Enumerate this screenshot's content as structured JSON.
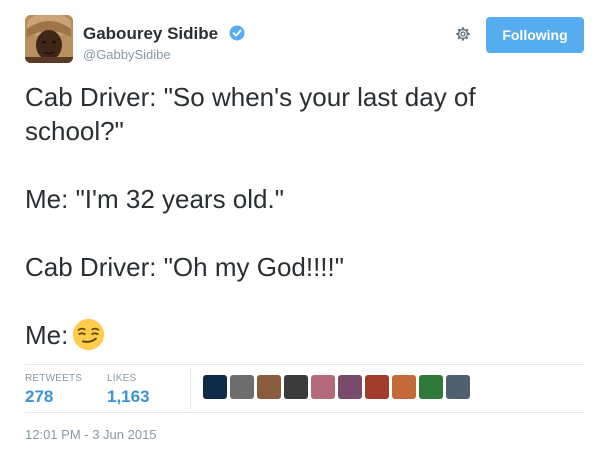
{
  "user": {
    "name": "Gabourey Sidibe",
    "handle": "@GabbySidibe"
  },
  "actions": {
    "follow_label": "Following"
  },
  "tweet": {
    "lines": [
      "Cab Driver: \"So when's your last day of",
      "school?\"",
      "Me: \"I'm 32 years old.\"",
      "Cab Driver: \"Oh my God!!!!\"",
      "Me:"
    ],
    "emoji": "smirking-face-emoji"
  },
  "stats": {
    "retweets_label": "RETWEETS",
    "retweets_count": "278",
    "likes_label": "LIKES",
    "likes_count": "1,163"
  },
  "likers": [
    {
      "color": "#0e2b4a"
    },
    {
      "color": "#6d6d6d"
    },
    {
      "color": "#8a5a3c"
    },
    {
      "color": "#3a3a3a"
    },
    {
      "color": "#b56a7a"
    },
    {
      "color": "#7a4a6a"
    },
    {
      "color": "#a23c2a"
    },
    {
      "color": "#c46a3a"
    },
    {
      "color": "#2f7a3a"
    },
    {
      "color": "#506070"
    }
  ],
  "timestamp": "12:01 PM - 3 Jun 2015",
  "colors": {
    "accent": "#55acee",
    "link": "#3b94d9",
    "muted": "#8899a6",
    "text": "#292f33"
  }
}
